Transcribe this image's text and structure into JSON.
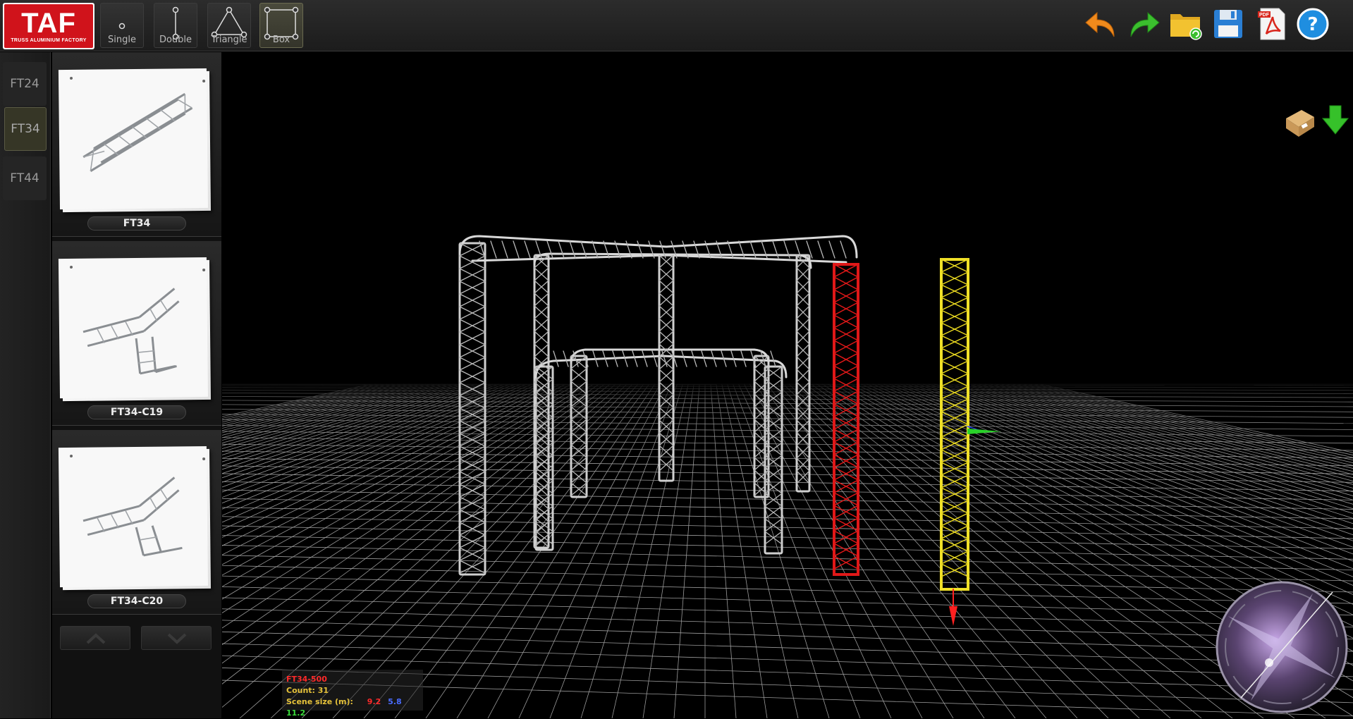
{
  "logo": {
    "main": "TAF",
    "sub": "TRUSS ALUMINIUM FACTORY"
  },
  "toolbar": {
    "types": [
      {
        "label": "Single",
        "icon": "single-truss-icon",
        "active": false
      },
      {
        "label": "Double",
        "icon": "double-truss-icon",
        "active": false
      },
      {
        "label": "Triangle",
        "icon": "triangle-truss-icon",
        "active": false
      },
      {
        "label": "Box",
        "icon": "box-truss-icon",
        "active": true
      }
    ],
    "actions": [
      {
        "name": "undo",
        "icon": "undo-arrow-icon",
        "color": "#f08a1c"
      },
      {
        "name": "redo",
        "icon": "redo-arrow-icon",
        "color": "#3bbf2e"
      },
      {
        "name": "open",
        "icon": "open-folder-icon",
        "color": "#f2c230"
      },
      {
        "name": "save",
        "icon": "floppy-save-icon",
        "color": "#2a7fd4"
      },
      {
        "name": "pdf",
        "icon": "pdf-export-icon",
        "color": "#d9261c"
      },
      {
        "name": "help",
        "icon": "help-question-icon",
        "color": "#1f8ee0"
      }
    ]
  },
  "series_tabs": [
    {
      "label": "FT24",
      "active": false
    },
    {
      "label": "FT34",
      "active": true
    },
    {
      "label": "FT44",
      "active": false
    }
  ],
  "catalog": {
    "items": [
      {
        "label": "FT34"
      },
      {
        "label": "FT34-C19"
      },
      {
        "label": "FT34-C20"
      }
    ]
  },
  "viewport_tools": [
    {
      "name": "package",
      "icon": "package-box-icon"
    },
    {
      "name": "drop",
      "icon": "green-down-arrow-icon"
    }
  ],
  "scene_info": {
    "selected": "FT34-500",
    "count": "Count: 31",
    "size_label": "Scene size (m):",
    "size_x": "9.2",
    "size_y": "5.8",
    "size_z": "11.2",
    "colors": {
      "selected": "#ff2a2a",
      "count": "#e6c23a",
      "size_label": "#e6c23a",
      "x": "#ff2a2a",
      "y": "#4a6cff",
      "z": "#3adc3a"
    }
  }
}
